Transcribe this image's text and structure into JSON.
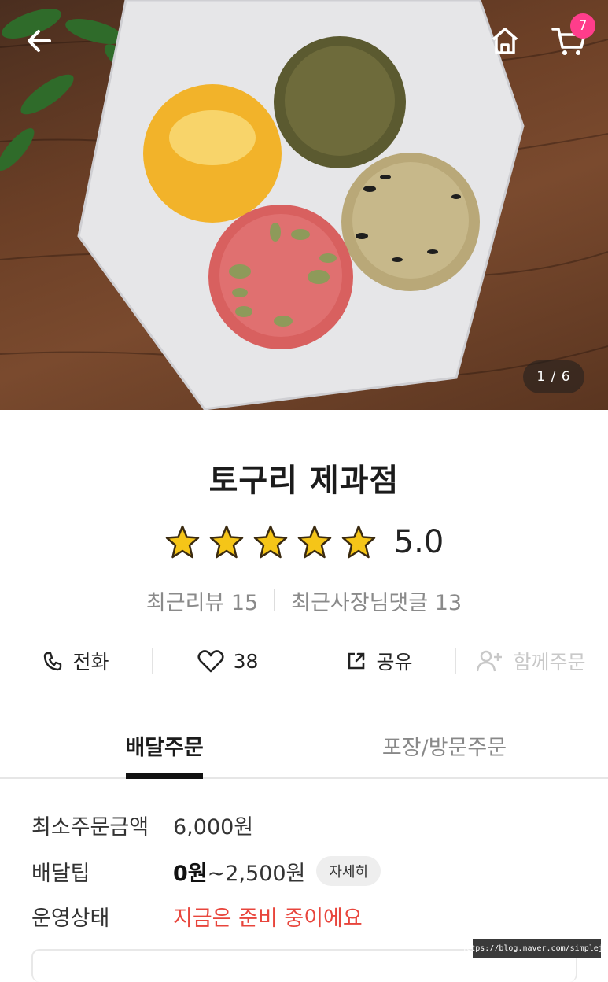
{
  "header": {
    "cart_count": "7",
    "image_pager": "1 / 6"
  },
  "store": {
    "name": "토구리 제과점",
    "rating": "5.0",
    "rating_stars": 5,
    "recent_reviews": "최근리뷰 15",
    "recent_owner_replies": "최근사장님댓글 13"
  },
  "actions": {
    "call": "전화",
    "like_count": "38",
    "share": "공유",
    "group_order": "함께주문"
  },
  "tabs": {
    "delivery": "배달주문",
    "pickup": "포장/방문주문"
  },
  "info": {
    "min_order_label": "최소주문금액",
    "min_order_value": "6,000원",
    "delivery_tip_label": "배달팁",
    "delivery_tip_min": "0원",
    "delivery_tip_rest": "~2,500원",
    "detail_button": "자세히",
    "status_label": "운영상태",
    "status_value": "지금은 준비 중이에요"
  },
  "watermark": "https://blog.naver.com/simplejj_",
  "colors": {
    "badge": "#ff3d8b",
    "status": "#e8453c",
    "star": "#f5c518"
  }
}
